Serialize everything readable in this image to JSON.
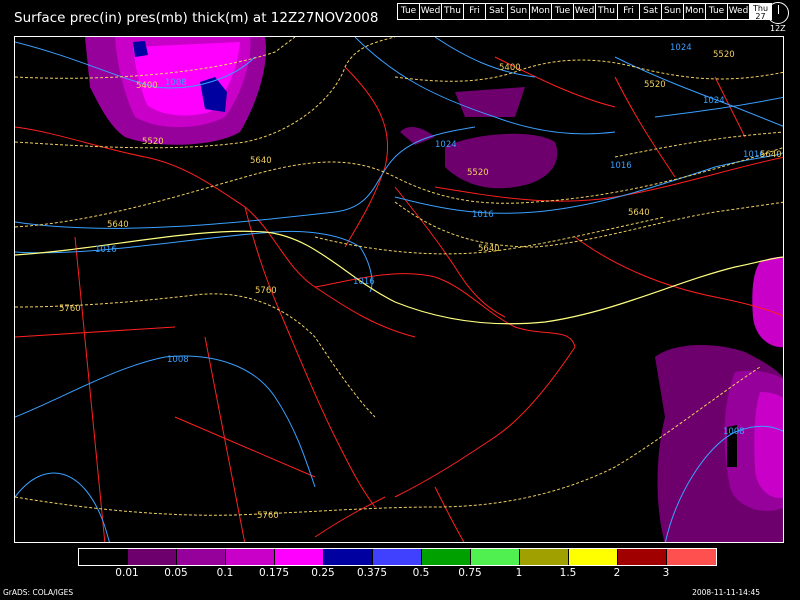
{
  "title": "Surface prec(in) pres(mb) thick(m) at 12Z27NOV2008",
  "days": [
    "Tue",
    "Wed",
    "Thu",
    "Fri",
    "Sat",
    "Sun",
    "Mon",
    "Tue",
    "Wed",
    "Thu",
    "Fri",
    "Sat",
    "Sun",
    "Mon",
    "Tue",
    "Wed"
  ],
  "current_day": {
    "name": "Thu",
    "date": "27"
  },
  "clock_label": "12Z",
  "colorbar": {
    "colors": [
      "#000000",
      "#6e006e",
      "#96009b",
      "#c800c8",
      "#ff00ff",
      "#0000a0",
      "#4040ff",
      "#00a000",
      "#50f050",
      "#a0a000",
      "#ffff00",
      "#a00000",
      "#ff5050"
    ],
    "labels": [
      "0.01",
      "0.05",
      "0.1",
      "0.175",
      "0.25",
      "0.375",
      "0.5",
      "0.75",
      "1",
      "1.5",
      "2",
      "3"
    ]
  },
  "contour_labels": {
    "pressure": [
      "1008",
      "1016",
      "1024",
      "1000",
      "1024",
      "1016",
      "1016",
      "1016",
      "1008",
      "1008",
      "1024",
      "1016"
    ],
    "thickness": [
      "5400",
      "5520",
      "5640",
      "5640",
      "5760",
      "5760",
      "5640",
      "5520",
      "5400",
      "5520",
      "5520",
      "5640",
      "5640",
      "5760",
      "5520"
    ]
  },
  "footer": {
    "left": "GrADS: COLA/IGES",
    "right": "2008-11-11-14:45"
  }
}
